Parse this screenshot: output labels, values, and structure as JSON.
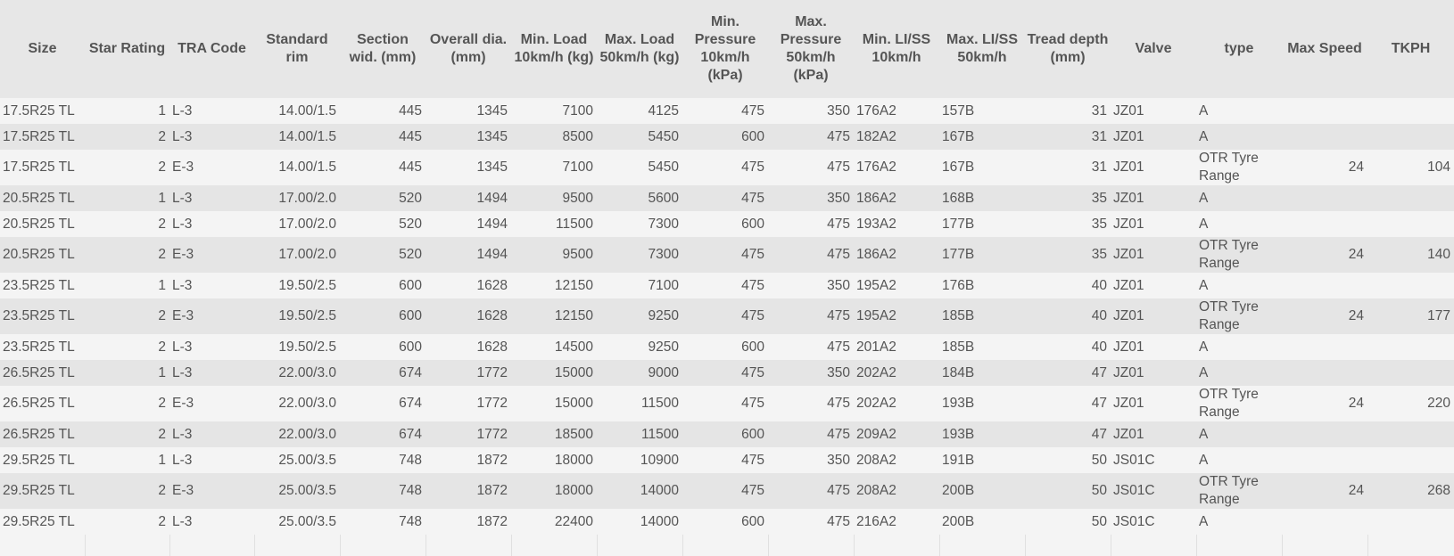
{
  "headers": [
    "Size",
    "Star Rating",
    "TRA Code",
    "Standard rim",
    "Section wid. (mm)",
    "Overall dia. (mm)",
    "Min. Load 10km/h (kg)",
    "Max. Load 50km/h (kg)",
    "Min. Pressure 10km/h (kPa)",
    "Max. Pressure 50km/h (kPa)",
    "Min. LI/SS 10km/h",
    "Max. LI/SS 50km/h",
    "Tread depth (mm)",
    "Valve",
    "type",
    "Max Speed",
    "TKPH"
  ],
  "rows": [
    [
      "17.5R25 TL",
      "1",
      "L-3",
      "14.00/1.5",
      "445",
      "1345",
      "7100",
      "4125",
      "475",
      "350",
      "176A2",
      "157B",
      "31",
      "JZ01",
      "A",
      "",
      ""
    ],
    [
      "17.5R25 TL",
      "2",
      "L-3",
      "14.00/1.5",
      "445",
      "1345",
      "8500",
      "5450",
      "600",
      "475",
      "182A2",
      "167B",
      "31",
      "JZ01",
      "A",
      "",
      ""
    ],
    [
      "17.5R25 TL",
      "2",
      "E-3",
      "14.00/1.5",
      "445",
      "1345",
      "7100",
      "5450",
      "475",
      "475",
      "176A2",
      "167B",
      "31",
      "JZ01",
      "OTR Tyre Range",
      "24",
      "104"
    ],
    [
      "20.5R25 TL",
      "1",
      "L-3",
      "17.00/2.0",
      "520",
      "1494",
      "9500",
      "5600",
      "475",
      "350",
      "186A2",
      "168B",
      "35",
      "JZ01",
      "A",
      "",
      ""
    ],
    [
      "20.5R25 TL",
      "2",
      "L-3",
      "17.00/2.0",
      "520",
      "1494",
      "11500",
      "7300",
      "600",
      "475",
      "193A2",
      "177B",
      "35",
      "JZ01",
      "A",
      "",
      ""
    ],
    [
      "20.5R25 TL",
      "2",
      "E-3",
      "17.00/2.0",
      "520",
      "1494",
      "9500",
      "7300",
      "475",
      "475",
      "186A2",
      "177B",
      "35",
      "JZ01",
      "OTR Tyre Range",
      "24",
      "140"
    ],
    [
      "23.5R25 TL",
      "1",
      "L-3",
      "19.50/2.5",
      "600",
      "1628",
      "12150",
      "7100",
      "475",
      "350",
      "195A2",
      "176B",
      "40",
      "JZ01",
      "A",
      "",
      ""
    ],
    [
      "23.5R25 TL",
      "2",
      "E-3",
      "19.50/2.5",
      "600",
      "1628",
      "12150",
      "9250",
      "475",
      "475",
      "195A2",
      "185B",
      "40",
      "JZ01",
      "OTR Tyre Range",
      "24",
      "177"
    ],
    [
      "23.5R25 TL",
      "2",
      "L-3",
      "19.50/2.5",
      "600",
      "1628",
      "14500",
      "9250",
      "600",
      "475",
      "201A2",
      "185B",
      "40",
      "JZ01",
      "A",
      "",
      ""
    ],
    [
      "26.5R25 TL",
      "1",
      "L-3",
      "22.00/3.0",
      "674",
      "1772",
      "15000",
      "9000",
      "475",
      "350",
      "202A2",
      "184B",
      "47",
      "JZ01",
      "A",
      "",
      ""
    ],
    [
      "26.5R25 TL",
      "2",
      "E-3",
      "22.00/3.0",
      "674",
      "1772",
      "15000",
      "11500",
      "475",
      "475",
      "202A2",
      "193B",
      "47",
      "JZ01",
      "OTR Tyre Range",
      "24",
      "220"
    ],
    [
      "26.5R25 TL",
      "2",
      "L-3",
      "22.00/3.0",
      "674",
      "1772",
      "18500",
      "11500",
      "600",
      "475",
      "209A2",
      "193B",
      "47",
      "JZ01",
      "A",
      "",
      ""
    ],
    [
      "29.5R25 TL",
      "1",
      "L-3",
      "25.00/3.5",
      "748",
      "1872",
      "18000",
      "10900",
      "475",
      "350",
      "208A2",
      "191B",
      "50",
      "JS01C",
      "A",
      "",
      ""
    ],
    [
      "29.5R25 TL",
      "2",
      "E-3",
      "25.00/3.5",
      "748",
      "1872",
      "18000",
      "14000",
      "475",
      "475",
      "208A2",
      "200B",
      "50",
      "JS01C",
      "OTR Tyre Range",
      "24",
      "268"
    ],
    [
      "29.5R25 TL",
      "2",
      "L-3",
      "25.00/3.5",
      "748",
      "1872",
      "22400",
      "14000",
      "600",
      "475",
      "216A2",
      "200B",
      "50",
      "JS01C",
      "A",
      "",
      ""
    ]
  ]
}
